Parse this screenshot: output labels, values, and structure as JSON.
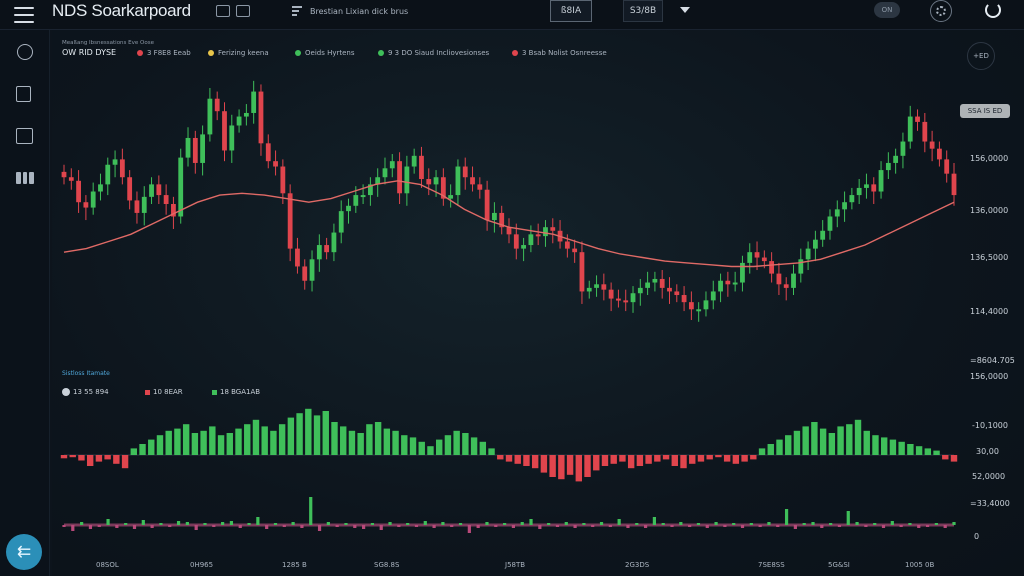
{
  "app": {
    "title": "NDS Soarkarpoard"
  },
  "toolbar": {
    "tag_text": "Brestian Lixian dick brus",
    "box1": "ß8IA",
    "box2": "S3/8B",
    "avatar_text": "ON"
  },
  "legend": {
    "header_line1": "Meaßang Ibsnessations Eve Oose",
    "header_line2": "OW RID DYSE",
    "items": [
      {
        "label": "3 F8E8 Eeab",
        "color": "#e0454d"
      },
      {
        "label": "Ferizing keena",
        "color": "#e8c54a"
      },
      {
        "label": "Oeids Hyrtens",
        "color": "#3fbf5a"
      },
      {
        "label": "9 3 DO Siaud Incliovesionses",
        "color": "#3fbf5a"
      },
      {
        "label": "3 Bsab Nolist Osnreesse",
        "color": "#e0454d"
      }
    ],
    "zoom_label": "+ED",
    "price_tag": "SSA IS ED"
  },
  "price_axis": [
    "156,0000",
    "136,0000",
    "136,5000",
    "114,4000",
    "=8604.705",
    "156,0000"
  ],
  "indicator": {
    "title": "Sistloss Itamate",
    "legend": [
      {
        "label": "13 55 894",
        "color": "#c9d1d9"
      },
      {
        "label": "10 8EAR",
        "color": "#e0454d"
      },
      {
        "label": "18 BGA1AB",
        "color": "#3fbf5a"
      }
    ],
    "axis": [
      "-10,1000",
      "30,00",
      "52,0000",
      "=33,4000",
      "0"
    ]
  },
  "time_axis": [
    "08SOL",
    "0H965",
    "1285 B",
    "SG8.8S",
    "J58TB",
    "2G3DS",
    "7SE8SS",
    "5G&SI",
    "1005 0B"
  ],
  "chart_data": [
    {
      "type": "candlestick",
      "title": "",
      "yticks": [
        "156,0000",
        "136,0000",
        "136,5000",
        "114,4000"
      ],
      "up_color": "#3fbf5a",
      "down_color": "#e0454d",
      "ma_color": "#e06a66",
      "closes": [
        190,
        188,
        176,
        173,
        182,
        186,
        197,
        200,
        190,
        177,
        170,
        179,
        186,
        180,
        175,
        168,
        201,
        212,
        198,
        214,
        234,
        227,
        205,
        219,
        224,
        226,
        238,
        209,
        199,
        196,
        181,
        150,
        140,
        132,
        144,
        152,
        148,
        159,
        171,
        174,
        180,
        180,
        186,
        190,
        195,
        199,
        181,
        196,
        202,
        189,
        186,
        190,
        178,
        180,
        196,
        190,
        186,
        183,
        166,
        170,
        162,
        158,
        150,
        152,
        158,
        157,
        162,
        160,
        154,
        150,
        148,
        126,
        128,
        130,
        127,
        122,
        121,
        120,
        125,
        128,
        131,
        133,
        128,
        126,
        124,
        120,
        116,
        116,
        121,
        126,
        132,
        130,
        131,
        142,
        148,
        145,
        143,
        136,
        130,
        128,
        136,
        144,
        150,
        155,
        160,
        168,
        172,
        176,
        180,
        184,
        186,
        182,
        194,
        198,
        202,
        210,
        224,
        221,
        210,
        206,
        200,
        192,
        180
      ],
      "ma": [
        148,
        150,
        154,
        158,
        164,
        170,
        176,
        180,
        181,
        180,
        178,
        176,
        178,
        182,
        186,
        188,
        186,
        180,
        172,
        166,
        162,
        160,
        158,
        154,
        150,
        147,
        145,
        143,
        142,
        141,
        140,
        140,
        141,
        142,
        144,
        148,
        152,
        158,
        164,
        170,
        176
      ]
    },
    {
      "type": "bar",
      "title": "",
      "series_values": [
        -3,
        -2,
        -5,
        -10,
        -6,
        -4,
        -8,
        -12,
        6,
        10,
        14,
        18,
        22,
        24,
        28,
        20,
        22,
        26,
        18,
        20,
        24,
        28,
        32,
        26,
        22,
        28,
        34,
        38,
        42,
        36,
        40,
        30,
        26,
        22,
        20,
        28,
        30,
        24,
        22,
        18,
        16,
        12,
        8,
        14,
        18,
        22,
        20,
        16,
        12,
        6,
        -4,
        -6,
        -8,
        -10,
        -12,
        -16,
        -20,
        -22,
        -18,
        -24,
        -20,
        -14,
        -10,
        -8,
        -6,
        -12,
        -10,
        -8,
        -6,
        -4,
        -10,
        -12,
        -8,
        -6,
        -4,
        -2,
        -6,
        -8,
        -6,
        -4,
        6,
        10,
        14,
        18,
        22,
        26,
        30,
        24,
        20,
        26,
        28,
        32,
        22,
        18,
        16,
        14,
        12,
        10,
        8,
        6,
        4,
        -4,
        -6
      ]
    },
    {
      "type": "bar",
      "title": "",
      "series_values": [
        -2,
        -6,
        3,
        -4,
        -2,
        6,
        -3,
        2,
        -4,
        5,
        -3,
        2,
        -2,
        4,
        3,
        -5,
        2,
        -2,
        3,
        4,
        -3,
        2,
        8,
        -4,
        2,
        -2,
        3,
        -3,
        28,
        -6,
        3,
        -2,
        2,
        -3,
        -4,
        2,
        -5,
        3,
        -2,
        2,
        -2,
        4,
        -3,
        3,
        -2,
        2,
        -8,
        -3,
        3,
        -2,
        2,
        -3,
        3,
        6,
        -4,
        2,
        -2,
        3,
        -3,
        2,
        -2,
        3,
        -2,
        6,
        -3,
        2,
        -3,
        8,
        2,
        -2,
        3,
        -2,
        2,
        -3,
        3,
        -2,
        2,
        -3,
        2,
        -2,
        3,
        -2,
        16,
        -4,
        2,
        3,
        -3,
        2,
        -2,
        14,
        3,
        -2,
        2,
        -3,
        4,
        -2,
        2,
        -3,
        -2,
        2,
        -3,
        3
      ]
    }
  ]
}
